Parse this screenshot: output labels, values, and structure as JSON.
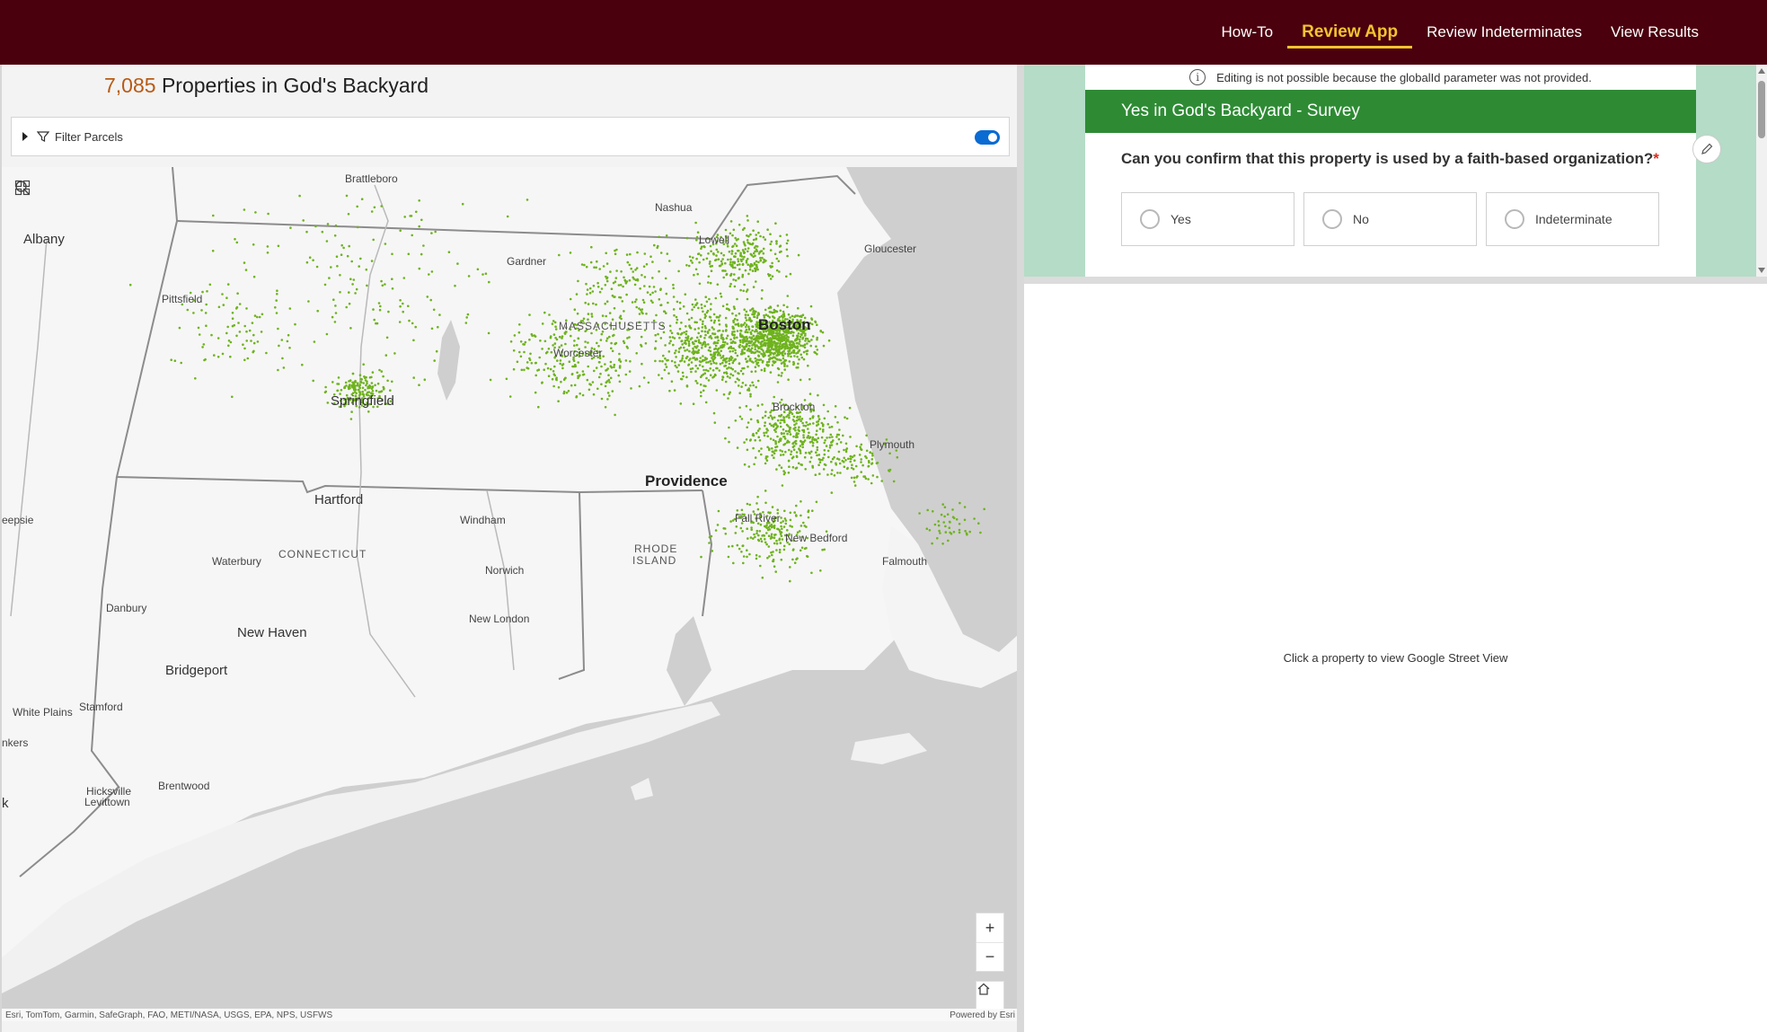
{
  "nav": {
    "items": [
      {
        "label": "How-To"
      },
      {
        "label": "Review App",
        "active": true
      },
      {
        "label": "Review Indeterminates"
      },
      {
        "label": "View Results"
      }
    ],
    "accent": "#f2c331",
    "background": "#4a000d"
  },
  "header": {
    "count": "7,085",
    "title": "Properties in God's Backyard"
  },
  "filter": {
    "label": "Filter Parcels",
    "enabled": true
  },
  "map": {
    "labels": {
      "brattleboro": "Brattleboro",
      "nashua": "Nashua",
      "albany": "Albany",
      "lowell": "Lowell",
      "gloucester": "Gloucester",
      "gardner": "Gardner",
      "pittsfield": "Pittsfield",
      "massachusetts": "MASSACHUSETTS",
      "boston": "Boston",
      "worcester": "Worcester",
      "springfield": "Springfield",
      "brockton": "Brockton",
      "plymouth": "Plymouth",
      "providence": "Providence",
      "hartford": "Hartford",
      "windham": "Windham",
      "eepsie": "eepsie",
      "fallriver": "Fall River",
      "newbedford": "New Bedford",
      "rhode": "RHODE",
      "island": "ISLAND",
      "waterbury": "Waterbury",
      "connecticut": "CONNECTICUT",
      "norwich": "Norwich",
      "falmouth": "Falmouth",
      "danbury": "Danbury",
      "newlondon": "New London",
      "newhaven": "New Haven",
      "bridgeport": "Bridgeport",
      "whiteplains": "White Plains",
      "stamford": "Stamford",
      "nkers": "nkers",
      "brentwood": "Brentwood",
      "hicksville": "Hicksville",
      "levittown": "Levittown",
      "k": "k"
    },
    "zoom_in": "+",
    "zoom_out": "−",
    "attribution_left": "Esri, TomTom, Garmin, SafeGraph, FAO, METI/NASA, USGS, EPA, NPS, USFWS",
    "attribution_right": "Powered by Esri",
    "dot_color": "#6fb31e"
  },
  "survey": {
    "notice": "Editing is not possible because the globalId parameter was not provided.",
    "title": "Yes in God's Backyard - Survey",
    "question": "Can you confirm that this property is used by a faith-based organization?",
    "required_mark": "*",
    "options": [
      "Yes",
      "No",
      "Indeterminate"
    ],
    "header_color": "#2e8b34"
  },
  "street_view": {
    "message": "Click a property to view Google Street View"
  }
}
